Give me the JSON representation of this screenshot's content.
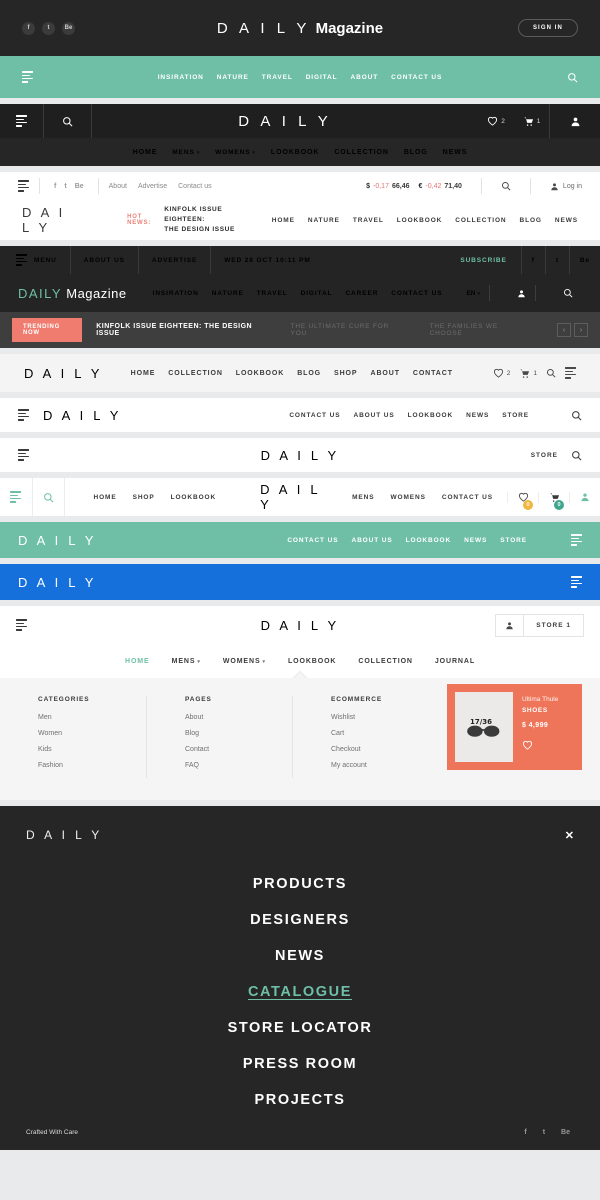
{
  "brand": {
    "daily": "D A I L Y",
    "daily_plain": "DAILY",
    "magazine": "Magazine"
  },
  "header_magazine": {
    "logo_daily": "D A I L Y",
    "logo_magazine": "Magazine",
    "sign_in": "SIGN IN",
    "socials": [
      "f",
      "t",
      "Be"
    ]
  },
  "teal_nav": {
    "items": [
      "INSIRATION",
      "NATURE",
      "TRAVEL",
      "DIGITAL",
      "ABOUT",
      "CONTACT US"
    ],
    "bg": "#6fbfa7"
  },
  "dark_shop_bar": {
    "logo": "D A I L Y",
    "wishlist_count": "2",
    "cart_count": "1"
  },
  "dark_sub_nav": {
    "items": [
      {
        "label": "HOME",
        "caret": false
      },
      {
        "label": "MENS",
        "caret": true
      },
      {
        "label": "WOMENS",
        "caret": true
      },
      {
        "label": "LOOKBOOK",
        "caret": false
      },
      {
        "label": "COLLECTION",
        "caret": false
      },
      {
        "label": "BLOG",
        "caret": false
      },
      {
        "label": "NEWS",
        "caret": false
      }
    ]
  },
  "utility_bar": {
    "socials": [
      "f",
      "t",
      "Be"
    ],
    "links": [
      "About",
      "Advertise",
      "Contact us"
    ],
    "ticker": [
      {
        "currency": "$",
        "change": "-0,17",
        "value": "66,46"
      },
      {
        "currency": "€",
        "change": "-0,42",
        "value": "71,40"
      }
    ],
    "login": "Log in"
  },
  "hot_news_bar": {
    "logo": "D A I L Y",
    "hot_label": "HOT NEWS:",
    "headline_line1": "KINFOLK ISSUE EIGHTEEN:",
    "headline_line2": "THE DESIGN ISSUE",
    "items": [
      "HOME",
      "NATURE",
      "TRAVEL",
      "LOOKBOOK",
      "COLLECTION",
      "BLOG",
      "NEWS"
    ]
  },
  "menu_date_bar": {
    "menu": "MENU",
    "about_us": "ABOUT US",
    "advertise": "ADVERTISE",
    "date": "WED 28 OCT 10:11 PM",
    "subscribe": "SUBSCRIBE",
    "socials": [
      "f",
      "t",
      "Be"
    ]
  },
  "magazine_dark_nav": {
    "logo_daily": "DAILY",
    "logo_magazine": "Magazine",
    "items": [
      "INSIRATION",
      "NATURE",
      "TRAVEL",
      "DIGITAL",
      "CAREER",
      "CONTACT US"
    ],
    "language": "EN"
  },
  "trending_bar": {
    "badge": "TRENDING NOW",
    "headline": "KINFOLK ISSUE EIGHTEEN: THE DESIGN ISSUE",
    "secondary": [
      "THE ULTIMATE CURE FOR YOU",
      "THE FAMILIES WE CHOOSE"
    ],
    "prev": "‹",
    "next": "›",
    "badge_color": "#ef7c6e"
  },
  "light_shop_nav": {
    "logo": "D A I L Y",
    "items": [
      "HOME",
      "COLLECTION",
      "LOOKBOOK",
      "BLOG",
      "SHOP",
      "ABOUT",
      "CONTACT"
    ],
    "wishlist_count": "2",
    "cart_count": "1"
  },
  "white_nav_a": {
    "logo": "D A I L Y",
    "items": [
      "CONTACT US",
      "ABOUT US",
      "LOOKBOOK",
      "NEWS",
      "STORE"
    ]
  },
  "white_nav_b": {
    "logo": "D A I L Y",
    "store": "STORE"
  },
  "split_nav": {
    "left_items": [
      "HOME",
      "SHOP",
      "LOOKBOOK"
    ],
    "logo": "D A I L Y",
    "right_items": [
      "MENS",
      "WOMENS",
      "CONTACT US"
    ],
    "wishlist_badge": "0",
    "cart_badge": "0"
  },
  "teal_bar": {
    "logo": "D A I L Y",
    "items": [
      "CONTACT US",
      "ABOUT US",
      "LOOKBOOK",
      "NEWS",
      "STORE"
    ],
    "bg": "#6fbfa7"
  },
  "blue_bar": {
    "logo": "D A I L Y",
    "bg": "#1570db"
  },
  "store_bar": {
    "logo": "D A I L Y",
    "store_label": "STORE 1"
  },
  "mega_nav": {
    "items": [
      {
        "label": "HOME",
        "active": true,
        "caret": false
      },
      {
        "label": "MENS",
        "active": false,
        "caret": true
      },
      {
        "label": "WOMENS",
        "active": false,
        "caret": true
      },
      {
        "label": "LOOKBOOK",
        "active": false,
        "caret": false
      },
      {
        "label": "COLLECTION",
        "active": false,
        "caret": false
      },
      {
        "label": "JOURNAL",
        "active": false,
        "caret": false
      }
    ]
  },
  "mega_panel": {
    "columns": [
      {
        "title": "CATEGORIES",
        "links": [
          "Men",
          "Women",
          "Kids",
          "Fashion"
        ]
      },
      {
        "title": "PAGES",
        "links": [
          "About",
          "Blog",
          "Contact",
          "FAQ"
        ]
      },
      {
        "title": "ECOMMERCE",
        "links": [
          "Wishlist",
          "Cart",
          "Checkout",
          "My account"
        ]
      }
    ],
    "promo": {
      "name": "Ultima Thule",
      "category": "SHOES",
      "price": "$ 4,999",
      "bg": "#ee7559"
    }
  },
  "overlay_menu": {
    "logo": "D A I L Y",
    "close": "✕",
    "items": [
      {
        "label": "PRODUCTS",
        "highlight": false
      },
      {
        "label": "DESIGNERS",
        "highlight": false
      },
      {
        "label": "NEWS",
        "highlight": false
      },
      {
        "label": "CATALOGUE",
        "highlight": true
      },
      {
        "label": "STORE LOCATOR",
        "highlight": false
      },
      {
        "label": "PRESS ROOM",
        "highlight": false
      },
      {
        "label": "PROJECTS",
        "highlight": false
      }
    ],
    "footer_text": "Crafted With Care",
    "socials": [
      "f",
      "t",
      "Be"
    ],
    "highlight_color": "#6fbfa7"
  }
}
